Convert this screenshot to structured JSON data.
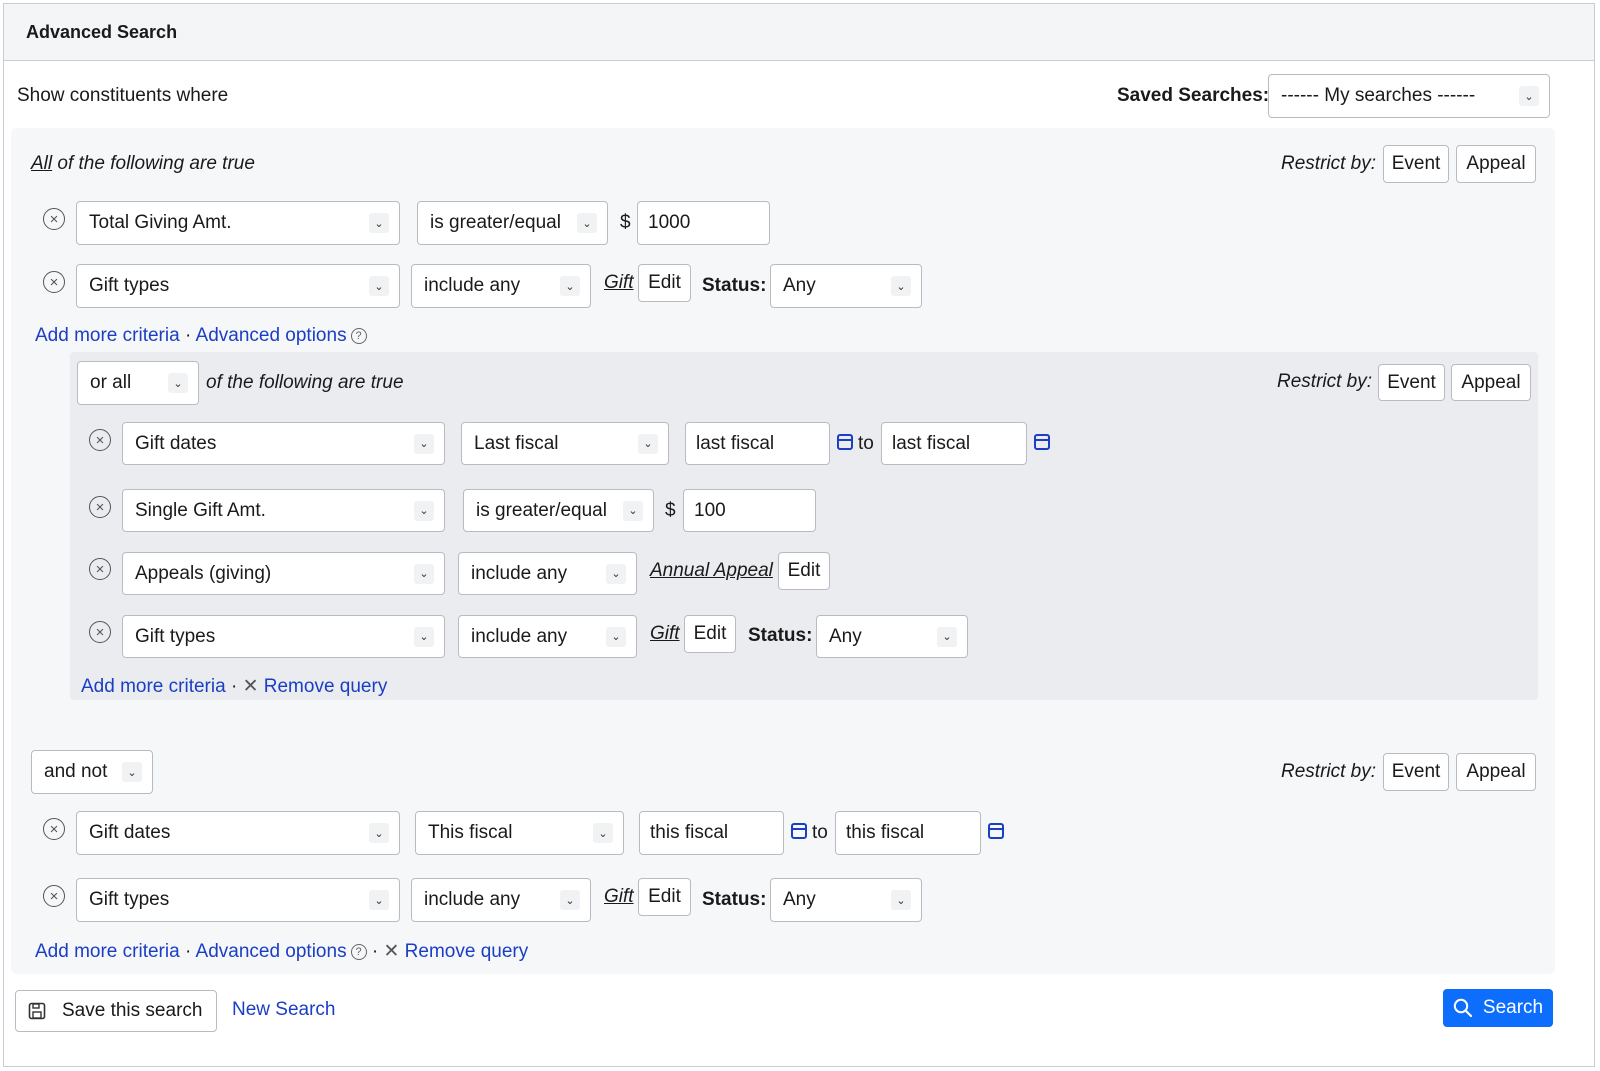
{
  "header": {
    "title": "Advanced Search"
  },
  "top": {
    "intro": "Show constituents where",
    "saved_label": "Saved Searches:",
    "saved_value": "------ My searches ------"
  },
  "restrict": {
    "label": "Restrict by:",
    "event": "Event",
    "appeal": "Appeal"
  },
  "group1": {
    "heading_all": "All",
    "heading_rest": " of the following are true",
    "row1": {
      "field": "Total Giving Amt.",
      "operator": "is greater/equal",
      "currency": "$",
      "value": "1000"
    },
    "row2": {
      "field": "Gift types",
      "operator": "include any",
      "link": "Gift",
      "edit": "Edit",
      "status_label": "Status:",
      "status_value": "Any"
    },
    "add_more": "Add more criteria",
    "sep": "·",
    "advanced": "Advanced options"
  },
  "group2": {
    "combinator": "or all",
    "heading": "of the following are true",
    "row1": {
      "field": "Gift dates",
      "operator": "Last fiscal",
      "from": "last fiscal",
      "to_label": "to",
      "to": "last fiscal"
    },
    "row2": {
      "field": "Single Gift Amt.",
      "operator": "is greater/equal",
      "currency": "$",
      "value": "100"
    },
    "row3": {
      "field": "Appeals (giving)",
      "operator": "include any",
      "link": "Annual Appeal",
      "edit": "Edit"
    },
    "row4": {
      "field": "Gift types",
      "operator": "include any",
      "link": "Gift",
      "edit": "Edit",
      "status_label": "Status:",
      "status_value": "Any"
    },
    "add_more": "Add more criteria",
    "sep": "·",
    "remove": "Remove query"
  },
  "group3": {
    "combinator": "and not",
    "row1": {
      "field": "Gift dates",
      "operator": "This fiscal",
      "from": "this fiscal",
      "to_label": "to",
      "to": "this fiscal"
    },
    "row2": {
      "field": "Gift types",
      "operator": "include any",
      "link": "Gift",
      "edit": "Edit",
      "status_label": "Status:",
      "status_value": "Any"
    },
    "add_more": "Add more criteria",
    "sep": "·",
    "advanced": "Advanced options",
    "sep2": "·",
    "remove": "Remove query"
  },
  "footer": {
    "save": "Save this search",
    "new_search": "New Search",
    "search": "Search"
  },
  "colors": {
    "link": "#1a3ec4",
    "primary": "#0d6efd",
    "group_bg": "#f6f7f9",
    "subgroup_bg": "#ebecf0"
  },
  "icons": [
    "remove-criteria-icon",
    "chevron-down-icon",
    "calendar-icon",
    "help-icon",
    "close-icon",
    "save-icon",
    "search-icon"
  ]
}
